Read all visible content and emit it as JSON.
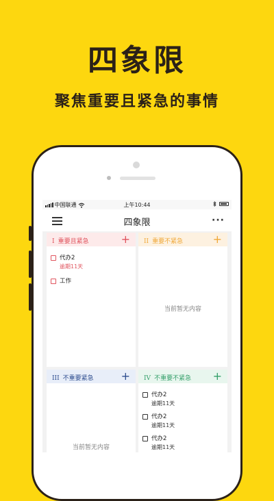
{
  "promo": {
    "title": "四象限",
    "subtitle": "聚焦重要且紧急的事情"
  },
  "status_bar": {
    "carrier": "中国联通",
    "time": "上午10:44"
  },
  "nav": {
    "menu_icon": "menu-icon",
    "title": "四象限",
    "more_label": "···"
  },
  "quadrants": [
    {
      "roman": "I",
      "label": "重要且紧急",
      "color": "#e0535d",
      "bg": "#fdeaea",
      "add": "+",
      "empty_text": "",
      "tasks": [
        {
          "title": "代办2",
          "due": "逾期11天",
          "due_color": "#e0535d",
          "check_color": "#e0535d"
        },
        {
          "title": "工作",
          "due": "",
          "due_color": "",
          "check_color": "#e0535d"
        }
      ]
    },
    {
      "roman": "II",
      "label": "重要不紧急",
      "color": "#f0a838",
      "bg": "#fdf1e0",
      "add": "+",
      "empty_text": "当前暂无内容",
      "tasks": []
    },
    {
      "roman": "III",
      "label": "不重要紧急",
      "color": "#2e4d8f",
      "bg": "#e8eef9",
      "add": "+",
      "empty_text": "当前暂无内容",
      "tasks": []
    },
    {
      "roman": "IV",
      "label": "不重要不紧急",
      "color": "#34a06a",
      "bg": "#e8f6ee",
      "add": "+",
      "empty_text": "",
      "tasks": [
        {
          "title": "代办2",
          "due": "逾期11天",
          "due_color": "#333333",
          "check_color": "#333333"
        },
        {
          "title": "代办2",
          "due": "逾期11天",
          "due_color": "#333333",
          "check_color": "#333333"
        },
        {
          "title": "代办2",
          "due": "逾期11天",
          "due_color": "#333333",
          "check_color": "#333333"
        }
      ]
    }
  ]
}
